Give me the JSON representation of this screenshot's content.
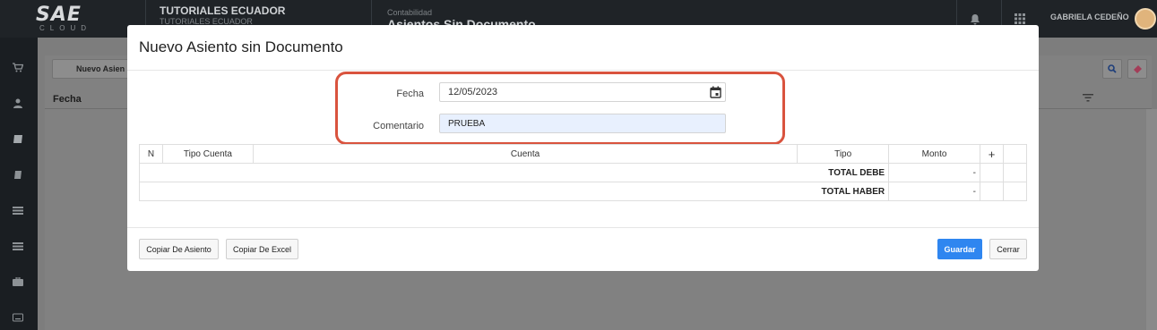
{
  "topbar": {
    "logo_text": "SAE",
    "logo_sub": "CLOUD",
    "company_name": "TUTORIALES ECUADOR",
    "company_sub": "TUTORIALES ECUADOR",
    "module_label": "Contabilidad",
    "module_title": "Asientos Sin Documento",
    "user_name": "GABRIELA CEDEÑO"
  },
  "background": {
    "toolbar_button": "Nuevo Asien",
    "grid_header": "Fecha"
  },
  "modal": {
    "title": "Nuevo Asiento sin Documento",
    "fecha_label": "Fecha",
    "fecha_value": "12/05/2023",
    "comentario_label": "Comentario",
    "comentario_value": "PRUEBA",
    "table": {
      "headers": [
        "N",
        "Tipo Cuenta",
        "Cuenta",
        "Tipo",
        "Monto",
        "+"
      ],
      "total_debe_label": "TOTAL DEBE",
      "total_debe_value": "-",
      "total_haber_label": "TOTAL HABER",
      "total_haber_value": "-"
    },
    "buttons": {
      "copy_entry": "Copiar De Asiento",
      "copy_excel": "Copiar De Excel",
      "save": "Guardar",
      "close": "Cerrar"
    }
  },
  "colors": {
    "highlight": "#d9533e",
    "primary": "#2f86f0",
    "input_fill": "#e8f0fe"
  }
}
